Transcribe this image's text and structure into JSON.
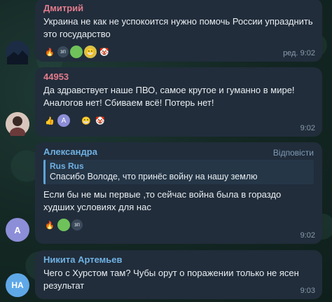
{
  "messages": [
    {
      "author": "Дмитрий",
      "author_color": "#e37b8c",
      "text": "Украина не как не успокоится нужно помочь России упразднить это государство",
      "time": "ред. 9:02",
      "reactions": [
        "🔥",
        "зп",
        "",
        "🤡"
      ]
    },
    {
      "author": "44953",
      "author_color": "#e37b8c",
      "text": "Да здравствует наше ПВО, самое крутое и гуманно в мире! Аналогов нет! Сбиваем всё! Потерь нет!",
      "time": "9:02",
      "reactions": [
        "👍",
        "A",
        "😁",
        "🤡"
      ]
    },
    {
      "author": "Александра",
      "author_color": "#6fb1e3",
      "reply_link": "Відповісти",
      "quote_author": "Rus Rus",
      "quote_text": "Спасибо Володе, что принёс войну на нашу землю",
      "text": "Если бы не мы первые ,то сейчас война была в гораздо худших условиях для нас",
      "time": "9:02",
      "avatar_letter": "A",
      "reactions": [
        "🔥",
        "",
        "зп"
      ]
    },
    {
      "author": "Никита Артемьев",
      "author_color": "#6fb1e3",
      "text": "Чего с Хурстом там? Чубы орут о поражении только не ясен результат",
      "time": "9:03",
      "avatar_letter": "НА"
    }
  ]
}
